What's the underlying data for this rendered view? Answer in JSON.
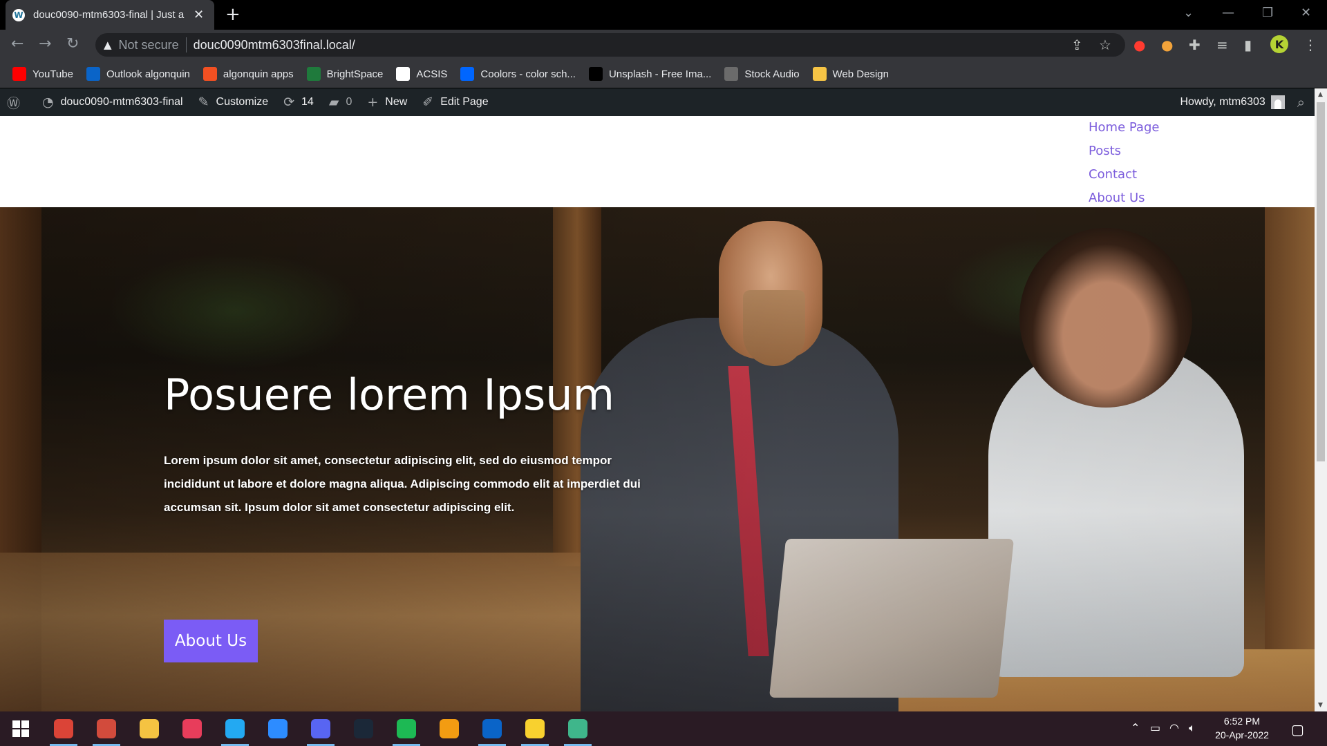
{
  "browser": {
    "tab_title": "douc0090-mtm6303-final | Just a",
    "tab_close": "✕",
    "new_tab": "+",
    "security_label": "Not secure",
    "url": "douc0090mtm6303final.local/",
    "profile_initial": "K"
  },
  "bookmarks": [
    {
      "label": "YouTube",
      "icon": "youtube-icon",
      "color": "#ff0000"
    },
    {
      "label": "Outlook algonquin",
      "icon": "outlook-icon",
      "color": "#0a64c8"
    },
    {
      "label": "algonquin apps",
      "icon": "microsoft-apps-icon",
      "color": "#f25022"
    },
    {
      "label": "BrightSpace",
      "icon": "brightspace-icon",
      "color": "#1f7a3c"
    },
    {
      "label": "ACSIS",
      "icon": "acsis-icon",
      "color": "#ffffff"
    },
    {
      "label": "Coolors - color sch...",
      "icon": "coolors-icon",
      "color": "#0066ff"
    },
    {
      "label": "Unsplash - Free Ima...",
      "icon": "unsplash-icon",
      "color": "#000000"
    },
    {
      "label": "Stock Audio",
      "icon": "stock-audio-icon",
      "color": "#6b6b6b"
    },
    {
      "label": "Web Design",
      "icon": "folder-icon",
      "color": "#f6c445"
    }
  ],
  "wp_admin_bar": {
    "site_name": "douc0090-mtm6303-final",
    "customize": "Customize",
    "updates_count": "14",
    "comments_count": "0",
    "new": "New",
    "edit_page": "Edit Page",
    "howdy": "Howdy, mtm6303"
  },
  "site_menu": [
    "Home Page",
    "Posts",
    "Contact",
    "About Us"
  ],
  "hero": {
    "title": "Posuere lorem Ipsum",
    "text": "Lorem ipsum dolor sit amet, consectetur adipiscing elit, sed do eiusmod tempor incididunt ut labore et dolore magna aliqua. Adipiscing commodo elit at imperdiet dui accumsan sit. Ipsum dolor sit amet consectetur adipiscing elit.",
    "button": "About Us"
  },
  "taskbar": {
    "apps": [
      {
        "name": "chrome-icon",
        "color": "#db4437",
        "active": true
      },
      {
        "name": "paint-app-icon",
        "color": "#d24b3c",
        "active": true
      },
      {
        "name": "file-explorer-icon",
        "color": "#f5c342",
        "active": false
      },
      {
        "name": "creative-cloud-icon",
        "color": "#e83d5b",
        "active": false
      },
      {
        "name": "vscode-icon",
        "color": "#23a9f2",
        "active": true
      },
      {
        "name": "zoom-icon",
        "color": "#2d8cff",
        "active": false
      },
      {
        "name": "discord-icon",
        "color": "#5865f2",
        "active": true
      },
      {
        "name": "steam-icon",
        "color": "#1b2838",
        "active": false
      },
      {
        "name": "spotify-icon",
        "color": "#1db954",
        "active": true
      },
      {
        "name": "medal-icon",
        "color": "#f39c12",
        "active": false
      },
      {
        "name": "outlook-icon",
        "color": "#0a64c8",
        "active": true
      },
      {
        "name": "sticky-notes-icon",
        "color": "#f8d12f",
        "active": true
      },
      {
        "name": "git-app-icon",
        "color": "#3fb68b",
        "active": true
      }
    ],
    "time": "6:52 PM",
    "date": "20-Apr-2022"
  }
}
